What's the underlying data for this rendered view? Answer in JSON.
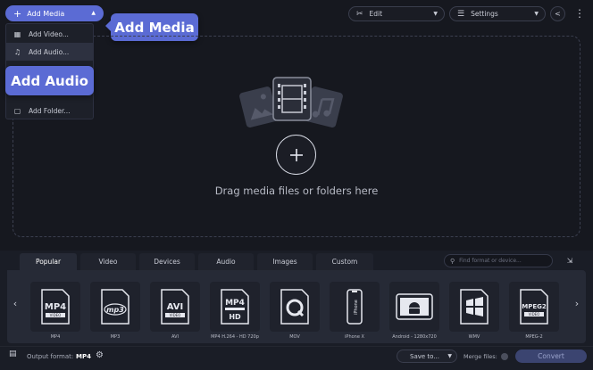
{
  "header": {
    "add_media_label": "Add Media",
    "edit_label": "Edit",
    "settings_label": "Settings"
  },
  "callouts": {
    "add_media": "Add Media",
    "add_audio": "Add Audio"
  },
  "add_media_menu": {
    "items": [
      {
        "label": "Add Video...",
        "icon": "film-icon"
      },
      {
        "label": "Add Audio...",
        "icon": "music-note-icon"
      },
      {
        "label": "Add Folder...",
        "icon": "folder-icon"
      }
    ]
  },
  "dropzone": {
    "text": "Drag media files or folders here"
  },
  "format_tabs": {
    "active": "Popular",
    "tabs": [
      "Popular",
      "Video",
      "Devices",
      "Audio",
      "Images",
      "Custom"
    ]
  },
  "format_search": {
    "placeholder": "Find format or device..."
  },
  "formats": [
    {
      "label": "MP4",
      "badge": "MP4",
      "sub": "VIDEO"
    },
    {
      "label": "MP3",
      "badge": "mp3",
      "sub": ""
    },
    {
      "label": "AVI",
      "badge": "AVI",
      "sub": "VIDEO"
    },
    {
      "label": "MP4 H.264 - HD 720p",
      "badge": "MP4",
      "sub": "HD"
    },
    {
      "label": "MOV",
      "badge": "",
      "sub": ""
    },
    {
      "label": "iPhone X",
      "badge": "iPhone",
      "sub": ""
    },
    {
      "label": "Android - 1280x720",
      "badge": "",
      "sub": ""
    },
    {
      "label": "WMV",
      "badge": "",
      "sub": ""
    },
    {
      "label": "MPEG-2",
      "badge": "MPEG2",
      "sub": "VIDEO"
    }
  ],
  "status": {
    "output_format_label": "Output format:",
    "output_format_value": "MP4",
    "save_to_label": "Save to...",
    "merge_files_label": "Merge files:",
    "convert_label": "Convert"
  },
  "colors": {
    "accent": "#5b6bd4",
    "background": "#16181f",
    "panel": "#262a36",
    "convert_disabled": "#3b4470"
  }
}
